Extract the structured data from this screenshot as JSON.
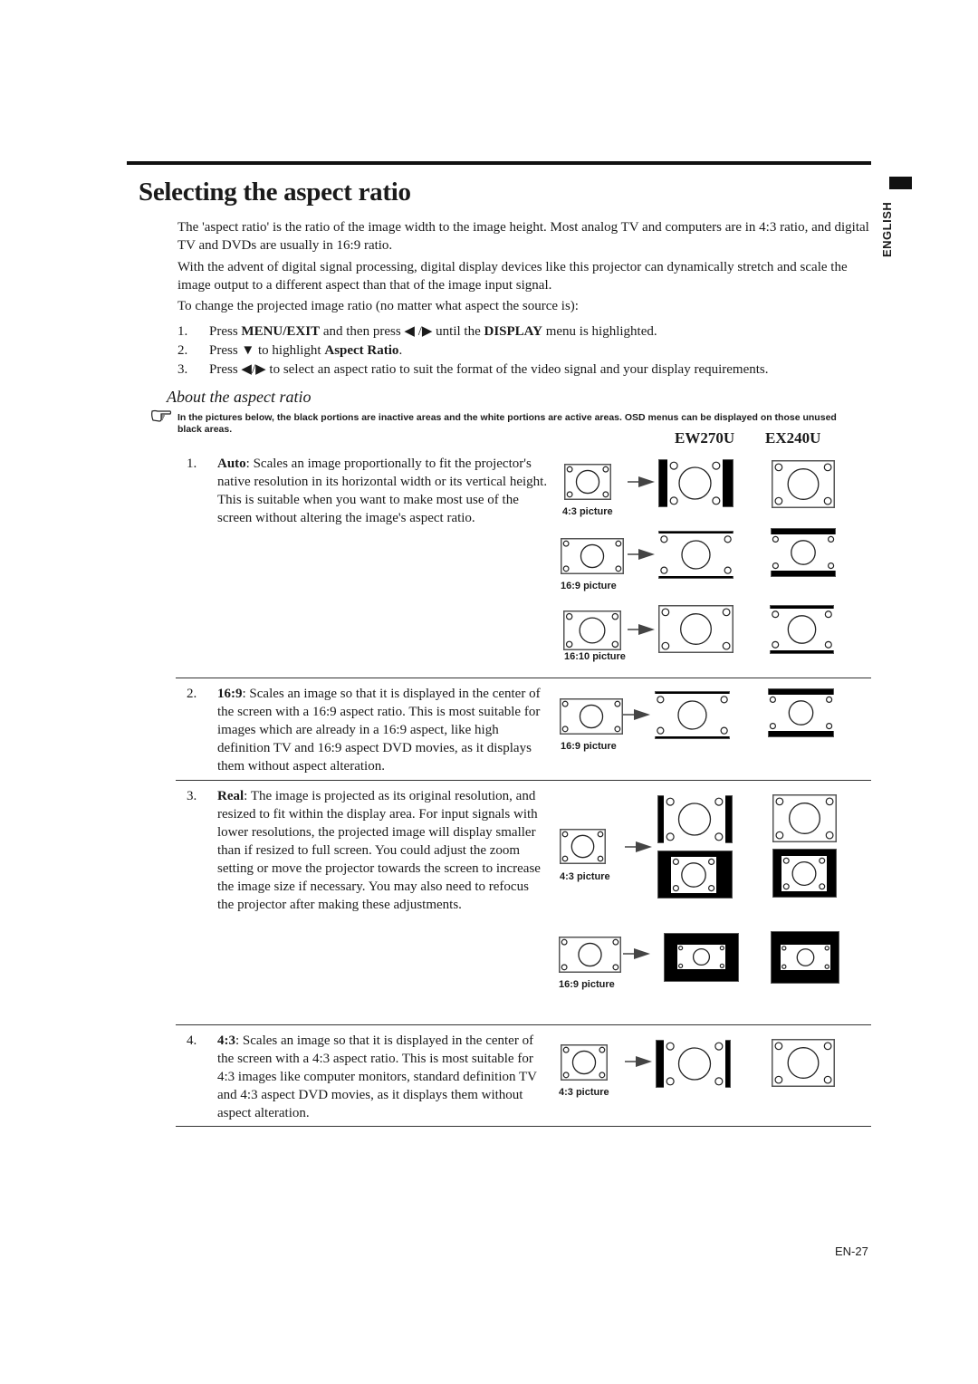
{
  "page": {
    "title": "Selecting the aspect ratio",
    "language_tab": "ENGLISH",
    "page_number": "EN-27"
  },
  "intro": {
    "p1": "The 'aspect ratio' is the ratio of the image width to the image height. Most analog TV and computers are in 4:3 ratio, and digital TV and DVDs are usually in 16:9 ratio.",
    "p2": "With the advent of digital signal processing, digital display devices like this projector can dynamically stretch and scale the image output to a different aspect than that of the image input signal.",
    "p3": "To change the projected image ratio (no matter what aspect the source is):"
  },
  "steps": [
    {
      "num": "1.",
      "pre": "Press ",
      "b1": "MENU/EXIT",
      "mid": " and then press ◀ /▶  until the ",
      "b2": "DISPLAY",
      "post": " menu is highlighted."
    },
    {
      "num": "2.",
      "pre": "Press ▼ to highlight ",
      "b1": "Aspect Ratio",
      "mid": ".",
      "b2": "",
      "post": ""
    },
    {
      "num": "3.",
      "pre": "Press ◀/▶ to select an aspect ratio to suit the format of the video signal and your display requirements.",
      "b1": "",
      "mid": "",
      "b2": "",
      "post": ""
    }
  ],
  "about": {
    "heading": "About the aspect ratio",
    "note_icon": "pointing-hand-icon",
    "note": "In the pictures below, the black portions are inactive areas and the white portions are active areas. OSD menus can be displayed on those unused black areas.",
    "models": [
      "EW270U",
      "EX240U"
    ]
  },
  "modes": [
    {
      "num": "1.",
      "name": "Auto",
      "desc": ": Scales an image proportionally to fit the projector's native resolution in its horizontal width or its vertical height. This is suitable when you want to make most use of the screen without altering the image's aspect ratio.",
      "captions": [
        "4:3 picture",
        "16:9 picture",
        "16:10 picture"
      ]
    },
    {
      "num": "2.",
      "name": "16:9",
      "desc": ": Scales an image so that it is displayed in the center of the screen with a 16:9 aspect ratio. This is most suitable for images which are already in a 16:9 aspect, like high definition TV and 16:9 aspect DVD movies, as it displays them without aspect alteration.",
      "captions": [
        "16:9 picture"
      ]
    },
    {
      "num": "3.",
      "name": "Real",
      "desc": ": The image is projected as its original resolution, and resized to fit within the display area. For input signals with lower resolutions, the projected image will display smaller than if resized to full screen. You could adjust the zoom setting or move the projector towards the screen to increase the image size if necessary. You may also need to refocus the projector after making these adjustments.",
      "captions": [
        "4:3 picture",
        "16:9 picture"
      ]
    },
    {
      "num": "4.",
      "name": "4:3",
      "desc": ": Scales an image so that it is displayed in the center of the screen with a 4:3 aspect ratio. This is most suitable for 4:3 images like computer monitors, standard definition TV and 4:3 aspect DVD movies, as it displays them without aspect alteration.",
      "captions": [
        "4:3 picture"
      ]
    }
  ]
}
